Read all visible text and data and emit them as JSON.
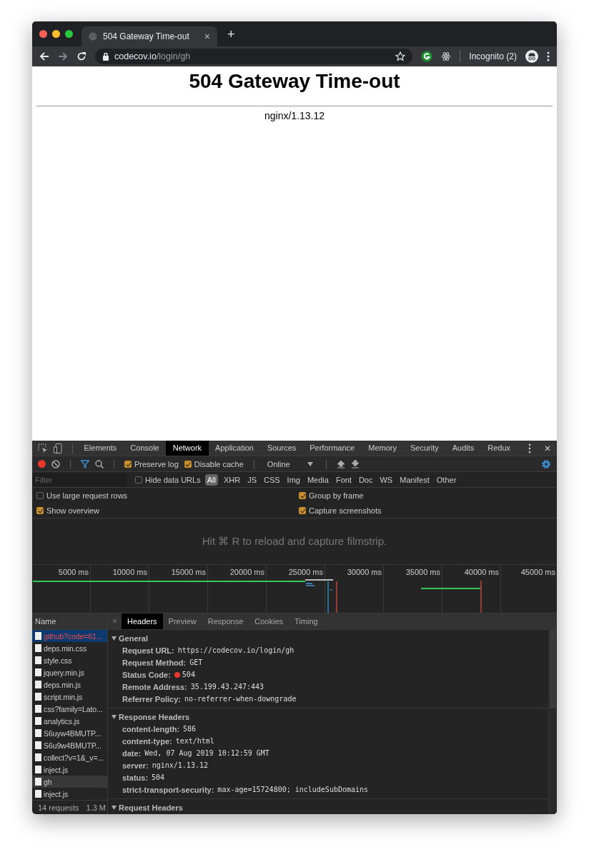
{
  "browser": {
    "tab_title": "504 Gateway Time-out",
    "close_tab": "×",
    "new_tab": "+",
    "address": {
      "host": "codecov.io",
      "path": "/login/gh"
    },
    "profile_label": "Incognito (2)"
  },
  "page": {
    "heading": "504 Gateway Time-out",
    "server": "nginx/1.13.12"
  },
  "devtools": {
    "tabs": [
      {
        "label": "Elements",
        "selected": false
      },
      {
        "label": "Console",
        "selected": false
      },
      {
        "label": "Network",
        "selected": true
      },
      {
        "label": "Application",
        "selected": false
      },
      {
        "label": "Sources",
        "selected": false
      },
      {
        "label": "Performance",
        "selected": false
      },
      {
        "label": "Memory",
        "selected": false
      },
      {
        "label": "Security",
        "selected": false
      },
      {
        "label": "Audits",
        "selected": false
      },
      {
        "label": "Redux",
        "selected": false
      }
    ],
    "close": "✕",
    "toolbar": {
      "options": [
        {
          "label": "Preserve log",
          "checked": true
        },
        {
          "label": "Disable cache",
          "checked": true
        }
      ],
      "throttle": "Online"
    },
    "filter": {
      "placeholder": "Filter",
      "hide_data_urls": {
        "label": "Hide data URLs",
        "checked": false
      },
      "types": [
        {
          "label": "All",
          "selected": true
        },
        {
          "label": "XHR",
          "selected": false
        },
        {
          "label": "JS",
          "selected": false
        },
        {
          "label": "CSS",
          "selected": false
        },
        {
          "label": "Img",
          "selected": false
        },
        {
          "label": "Media",
          "selected": false
        },
        {
          "label": "Font",
          "selected": false
        },
        {
          "label": "Doc",
          "selected": false
        },
        {
          "label": "WS",
          "selected": false
        },
        {
          "label": "Manifest",
          "selected": false
        },
        {
          "label": "Other",
          "selected": false
        }
      ]
    },
    "settings": [
      {
        "label": "Use large request rows",
        "checked": false
      },
      {
        "label": "Group by frame",
        "checked": true
      },
      {
        "label": "Show overview",
        "checked": true
      },
      {
        "label": "Capture screenshots",
        "checked": true
      }
    ],
    "filmstrip_hint": "Hit ⌘ R to reload and capture filmstrip.",
    "overview_ticks": [
      "5000 ms",
      "10000 ms",
      "15000 ms",
      "20000 ms",
      "25000 ms",
      "30000 ms",
      "35000 ms",
      "40000 ms",
      "45000 ms"
    ],
    "requests": {
      "header": "Name",
      "items": [
        {
          "name": "github?code=61...",
          "selected": true,
          "hovered": false,
          "failed": true
        },
        {
          "name": "deps.min.css",
          "selected": false,
          "hovered": false,
          "failed": false
        },
        {
          "name": "style.css",
          "selected": false,
          "hovered": false,
          "failed": false
        },
        {
          "name": "jquery.min.js",
          "selected": false,
          "hovered": false,
          "failed": false
        },
        {
          "name": "deps.min.js",
          "selected": false,
          "hovered": false,
          "failed": false
        },
        {
          "name": "script.min.js",
          "selected": false,
          "hovered": false,
          "failed": false
        },
        {
          "name": "css?family=Lato...",
          "selected": false,
          "hovered": false,
          "failed": false
        },
        {
          "name": "analytics.js",
          "selected": false,
          "hovered": false,
          "failed": false
        },
        {
          "name": "S6uyw4BMUTP...",
          "selected": false,
          "hovered": false,
          "failed": false
        },
        {
          "name": "S6u9w4BMUTP...",
          "selected": false,
          "hovered": false,
          "failed": false
        },
        {
          "name": "collect?v=1&_v=...",
          "selected": false,
          "hovered": false,
          "failed": false
        },
        {
          "name": "inject.js",
          "selected": false,
          "hovered": false,
          "failed": false
        },
        {
          "name": "gh",
          "selected": false,
          "hovered": true,
          "failed": false
        },
        {
          "name": "inject.js",
          "selected": false,
          "hovered": false,
          "failed": false
        }
      ],
      "summary": [
        "14 requests",
        "1.3 M"
      ]
    },
    "detail": {
      "close": "×",
      "tabs": [
        {
          "label": "Headers",
          "selected": true
        },
        {
          "label": "Preview",
          "selected": false
        },
        {
          "label": "Response",
          "selected": false
        },
        {
          "label": "Cookies",
          "selected": false
        },
        {
          "label": "Timing",
          "selected": false
        }
      ],
      "sections": [
        {
          "title": "General",
          "expanded": true,
          "rows": [
            {
              "key": "Request URL:",
              "value": "https://codecov.io/login/gh",
              "kind": "plain"
            },
            {
              "key": "Request Method:",
              "value": "GET",
              "kind": "plain"
            },
            {
              "key": "Status Code:",
              "value": "504",
              "kind": "status",
              "color": "#e8382e"
            },
            {
              "key": "Remote Address:",
              "value": "35.199.43.247:443",
              "kind": "plain"
            },
            {
              "key": "Referrer Policy:",
              "value": "no-referrer-when-downgrade",
              "kind": "plain"
            }
          ]
        },
        {
          "title": "Response Headers",
          "expanded": true,
          "rows": [
            {
              "key": "content-length:",
              "value": "586",
              "kind": "plain"
            },
            {
              "key": "content-type:",
              "value": "text/html",
              "kind": "plain"
            },
            {
              "key": "date:",
              "value": "Wed, 07 Aug 2019 10:12:59 GMT",
              "kind": "plain"
            },
            {
              "key": "server:",
              "value": "nginx/1.13.12",
              "kind": "plain"
            },
            {
              "key": "status:",
              "value": "504",
              "kind": "plain"
            },
            {
              "key": "strict-transport-security:",
              "value": "max-age=15724800; includeSubDomains",
              "kind": "plain"
            }
          ]
        },
        {
          "title": "Request Headers",
          "expanded": true
        }
      ]
    }
  }
}
